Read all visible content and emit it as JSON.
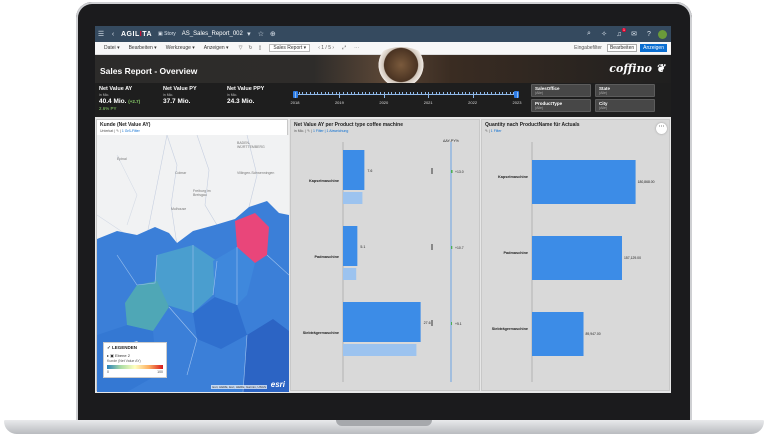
{
  "shell": {
    "logo_prefix": "AGIL",
    "logo_x": "I",
    "logo_suffix": "TA",
    "story_label": "Story",
    "file_name": "AS_Sales_Report_002",
    "notification_count": "1"
  },
  "toolbar": {
    "menu": [
      "Datei",
      "Bearbeiten",
      "Werkzeuge",
      "Anzeigen"
    ],
    "page_select": "Sales Report",
    "page_number": "1 / 5",
    "input_control_label": "Eingabefilter",
    "edit_label": "Bearbeiten",
    "view_label": "Anzeigen"
  },
  "header": {
    "title": "Sales Report  - Overview",
    "brand": "coffino"
  },
  "kpis": [
    {
      "title": "Net Value AY",
      "sub": "in Mio.",
      "value": "40.4 Mio.",
      "delta": "(+2.7)",
      "delta2": "2.6% PY"
    },
    {
      "title": "Net Value PY",
      "sub": "in Mio.",
      "value": "37.7 Mio."
    },
    {
      "title": "Net Value PPY",
      "sub": "in Mio.",
      "value": "24.3 Mio."
    }
  ],
  "timeline": {
    "years": [
      "2018",
      "2019",
      "2020",
      "2021",
      "2022",
      "2023"
    ]
  },
  "filters": [
    {
      "label": "SalesOffice",
      "value": "(Alle)"
    },
    {
      "label": "State",
      "value": "(Alle)"
    },
    {
      "label": "ProductType",
      "value": "(Alle)"
    },
    {
      "label": "City",
      "value": "(Alle)"
    }
  ],
  "map_panel": {
    "title": "Kunde (Net Value AY)",
    "sub_prefix": "Unterkat",
    "sub_link": "1 Grß-Filter",
    "legend_title": "LEGENDEN",
    "legend_item": "Ebene 2",
    "legend_measure": "Kunde (Net Value AY)",
    "legend_min": "0",
    "legend_max": "100",
    "places": [
      "Épinal",
      "Colmar",
      "Freiburg im Breisgau",
      "Mulhouse",
      "Villingen-Schwenningen",
      "BADEN-WÜRTTEMBERG"
    ],
    "attribution": "Esri, HERE, Esri, HERE, Garmin, USGS",
    "esri": "esri"
  },
  "bar_panel": {
    "title": "Net Value AY per Product type coffee machine",
    "sub_prefix": "in Mio.",
    "sub_link": "1 Filter | 1 Abweichung",
    "delta_header": "ΔAY-PY%"
  },
  "qty_panel": {
    "title": "Quantity nach ProductName für Actuals",
    "sub_link": "1 Filter"
  },
  "chart_data": [
    {
      "type": "bar",
      "title": "Net Value AY per Product type coffee machine",
      "categories": [
        "Kapselmaschine",
        "Padmaschine",
        "Siebträgermaschine"
      ],
      "series": [
        {
          "name": "",
          "values": [
            7.6,
            5.1,
            27.6
          ]
        },
        {
          "name": "",
          "values": [
            6.9,
            4.7,
            26.1
          ]
        }
      ],
      "value_labels": [
        "7.6",
        "5.1",
        "27.6"
      ],
      "deltas": [
        13.0,
        10.7,
        5.1
      ],
      "delta_labels": [
        "+13.0",
        "+10.7",
        "+5.1"
      ],
      "xlim": [
        0,
        32
      ]
    },
    {
      "type": "bar",
      "title": "Quantity nach ProductName für Actuals",
      "categories": [
        "Kapselmaschine",
        "Padmaschine",
        "Siebträgermaschine"
      ],
      "values": [
        180868,
        157129,
        89947
      ],
      "value_labels": [
        "180,868.00",
        "157,129.00",
        "89,947.00"
      ],
      "xlim": [
        0,
        220000
      ]
    }
  ],
  "colors": {
    "shell": "#354a5f",
    "accent": "#0a6ed1",
    "bar": "#3c8ce7",
    "bar_light": "#9cc3ef",
    "positive": "#4caf50",
    "map_highlight": "#e9467a"
  }
}
